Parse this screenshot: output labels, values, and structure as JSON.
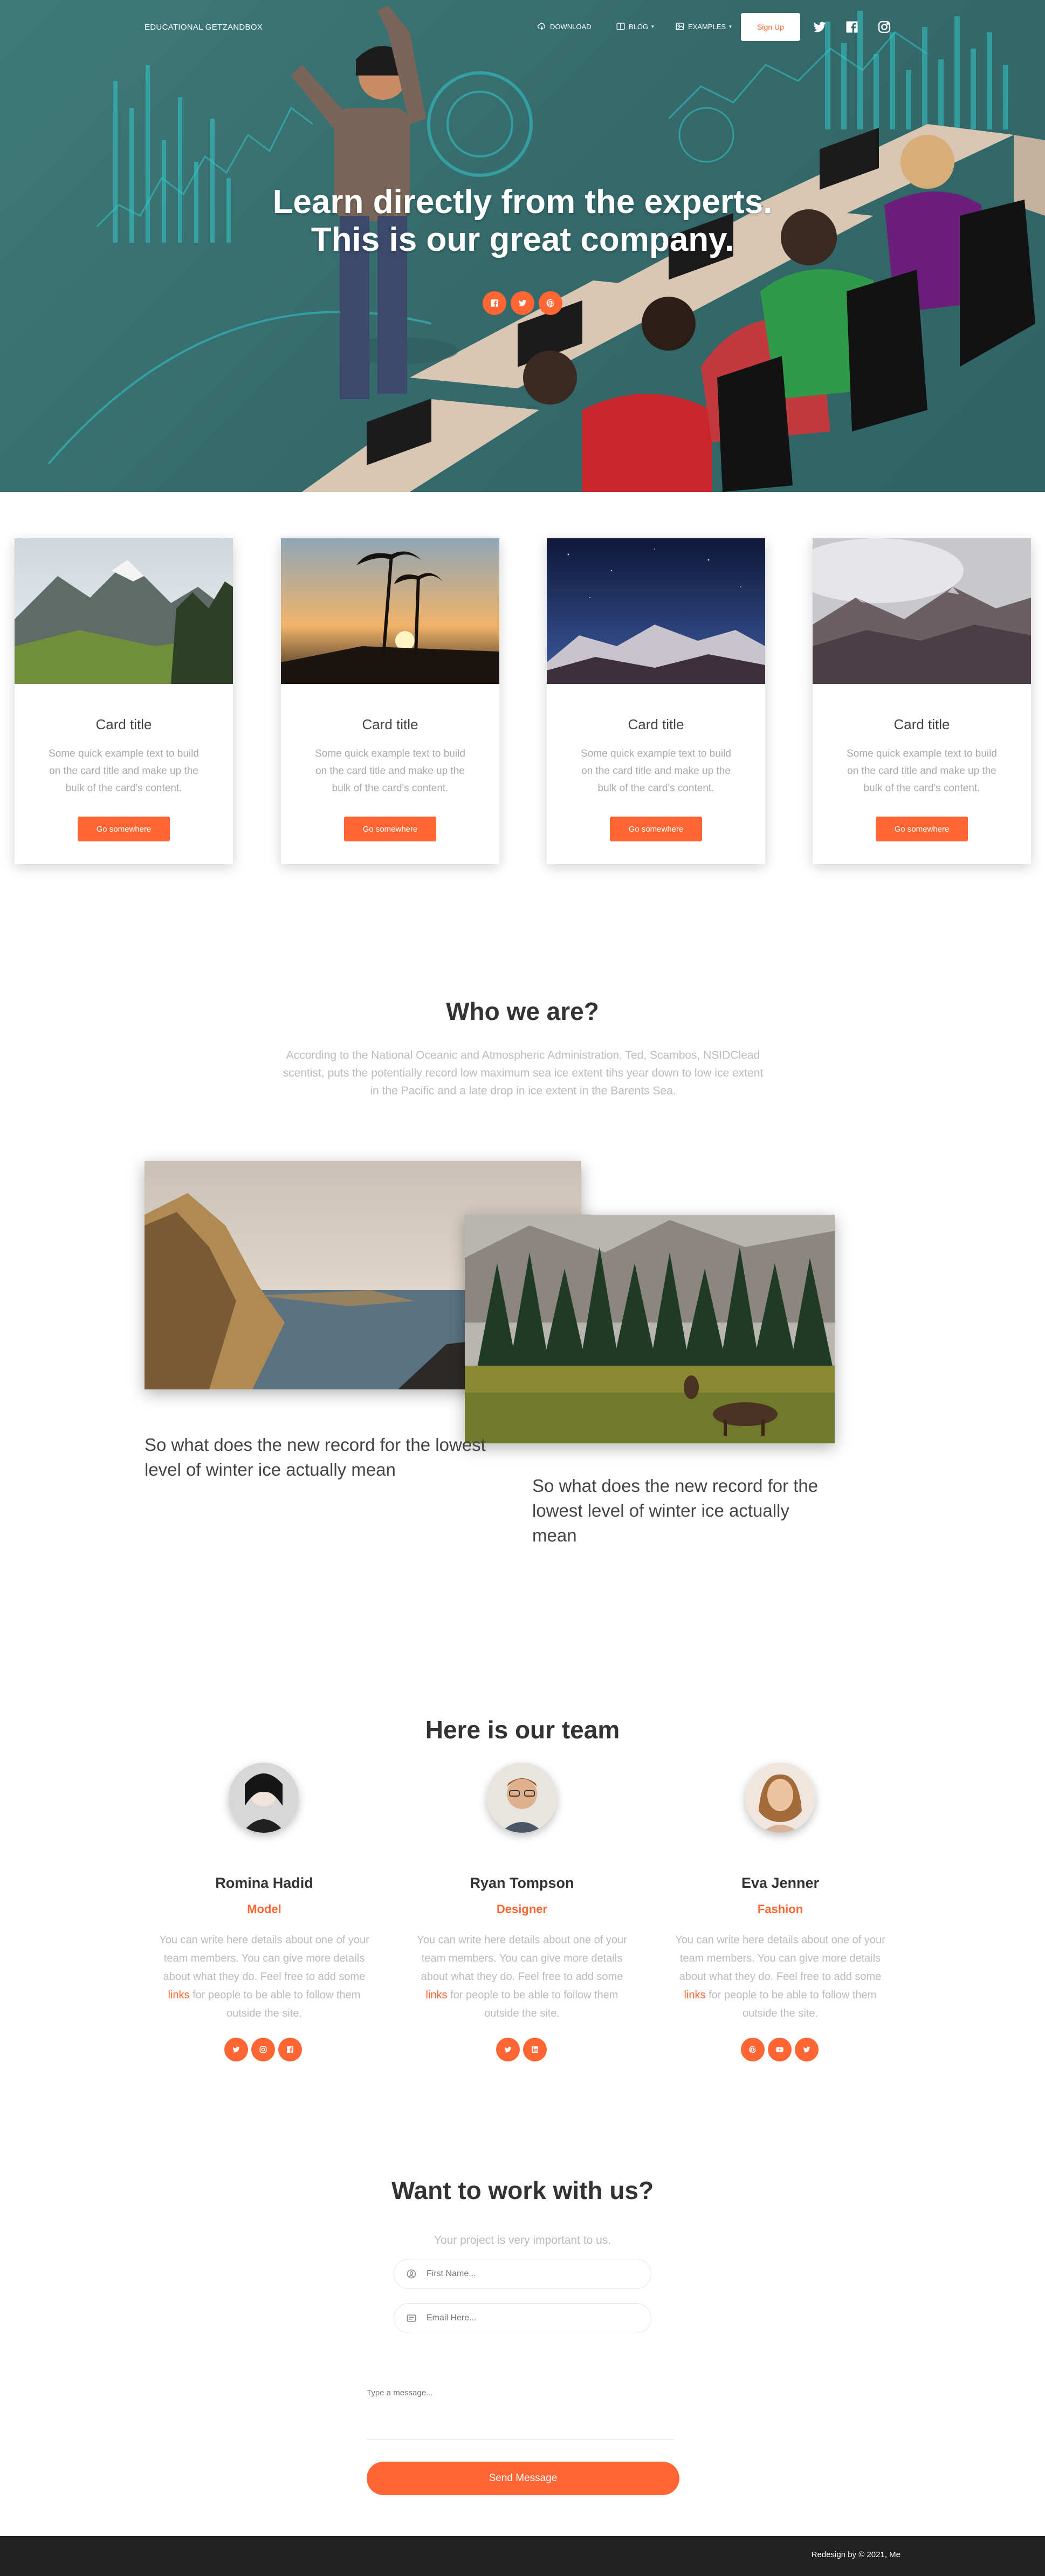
{
  "colors": {
    "accent": "#ff6633",
    "hero_bg": "#3a7575",
    "footer_bg": "#222222"
  },
  "navbar": {
    "brand": "EDUCATIONAL GETZANDBOX",
    "items": [
      {
        "label": "DOWNLOAD",
        "icon": "cloud-download-icon"
      },
      {
        "label": "BLOG",
        "icon": "book-icon"
      },
      {
        "label": "EXAMPLES",
        "icon": "image-icon"
      }
    ],
    "signup_label": "Sign Up",
    "social": [
      "twitter-icon",
      "facebook-icon",
      "instagram-icon"
    ]
  },
  "hero": {
    "title_line1": "Learn directly from the experts.",
    "title_line2": "This is our great company.",
    "social": [
      "facebook-icon",
      "twitter-icon",
      "pinterest-icon"
    ]
  },
  "cards": [
    {
      "title": "Card title",
      "text": "Some quick example text to build on the card title and make up the bulk of the card's content.",
      "button": "Go somewhere",
      "image": "mountain-valley-photo"
    },
    {
      "title": "Card title",
      "text": "Some quick example text to build on the card title and make up the bulk of the card's content.",
      "button": "Go somewhere",
      "image": "palm-sunset-photo"
    },
    {
      "title": "Card title",
      "text": "Some quick example text to build on the card title and make up the bulk of the card's content.",
      "button": "Go somewhere",
      "image": "night-mountain-photo"
    },
    {
      "title": "Card title",
      "text": "Some quick example text to build on the card title and make up the bulk of the card's content.",
      "button": "Go somewhere",
      "image": "snowy-forest-photo"
    }
  ],
  "who": {
    "title": "Who we are?",
    "text": "According to the National Oceanic and Atmospheric Administration, Ted, Scambos, NSIDClead scentist, puts the potentially record low maximum sea ice extent tihs year down to low ice extent in the Pacific and a late drop in ice extent in the Barents Sea.",
    "caption_left": "So what does the new record for the lowest level of winter ice actually mean",
    "caption_right": "So what does the new record for the lowest level of winter ice actually mean"
  },
  "team": {
    "title": "Here is our team",
    "bio_before": "You can write here details about one of your team members. You can give more details about what they do. Feel free to add some ",
    "bio_link": "links",
    "bio_after": " for people to be able to follow them outside the site.",
    "members": [
      {
        "name": "Romina Hadid",
        "role": "Model",
        "social": [
          "twitter-icon",
          "instagram-icon",
          "facebook-icon"
        ]
      },
      {
        "name": "Ryan Tompson",
        "role": "Designer",
        "social": [
          "twitter-icon",
          "linkedin-icon"
        ]
      },
      {
        "name": "Eva Jenner",
        "role": "Fashion",
        "social": [
          "pinterest-icon",
          "youtube-icon",
          "twitter-icon"
        ]
      }
    ]
  },
  "contact": {
    "title": "Want to work with us?",
    "subtitle": "Your project is very important to us.",
    "first_name_placeholder": "First Name...",
    "email_placeholder": "Email Here...",
    "message_placeholder": "Type a message...",
    "send_label": "Send Message"
  },
  "footer": {
    "text": "Redesign by © 2021, Me"
  }
}
